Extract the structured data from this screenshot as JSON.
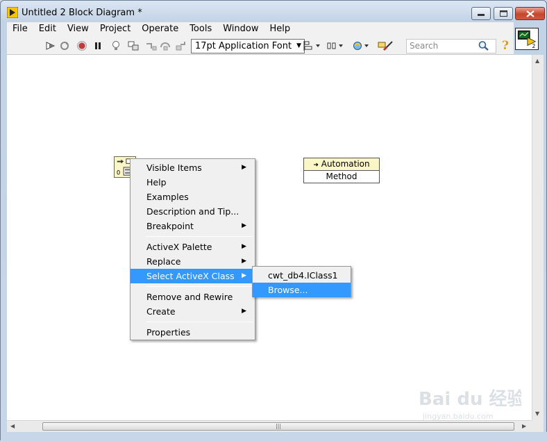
{
  "window": {
    "title": "Untitled 2 Block Diagram *"
  },
  "menubar": {
    "items": [
      "File",
      "Edit",
      "View",
      "Project",
      "Operate",
      "Tools",
      "Window",
      "Help"
    ]
  },
  "toolbar": {
    "font_select": "17pt Application Font",
    "search_placeholder": "Search",
    "help_glyph": "?",
    "icons": [
      "run-arrow-icon",
      "highlight-execution-icon",
      "abort-icon",
      "pause-icon",
      "lightbulb-icon",
      "retain-wire-values-icon",
      "step-into-icon",
      "step-over-icon",
      "step-out-icon",
      "align-objects-icon",
      "distribute-objects-icon",
      "reorder-icon",
      "cleanup-diagram-icon"
    ]
  },
  "diagram": {
    "automation_node": {
      "top": "Automation",
      "bottom": "Method"
    },
    "context_menu": {
      "items": [
        {
          "label": "Visible Items",
          "submenu": true
        },
        {
          "label": "Help",
          "submenu": false
        },
        {
          "label": "Examples",
          "submenu": false
        },
        {
          "label": "Description and Tip...",
          "submenu": false
        },
        {
          "label": "Breakpoint",
          "submenu": true
        },
        {
          "label": "ActiveX Palette",
          "submenu": true
        },
        {
          "label": "Replace",
          "submenu": true
        },
        {
          "label": "Select ActiveX Class",
          "submenu": true,
          "selected": true
        },
        {
          "label": "Remove and Rewire",
          "submenu": false
        },
        {
          "label": "Create",
          "submenu": true
        },
        {
          "label": "Properties",
          "submenu": false
        }
      ]
    },
    "submenu": {
      "items": [
        {
          "label": "cwt_db4.IClass1"
        },
        {
          "label": "Browse...",
          "selected": true
        }
      ]
    }
  },
  "watermark": {
    "text": "Bai du 经验",
    "url_text": "jingyan.baidu.com"
  },
  "colors": {
    "selection": "#3399ff",
    "node_fill": "#fbf6c8"
  }
}
